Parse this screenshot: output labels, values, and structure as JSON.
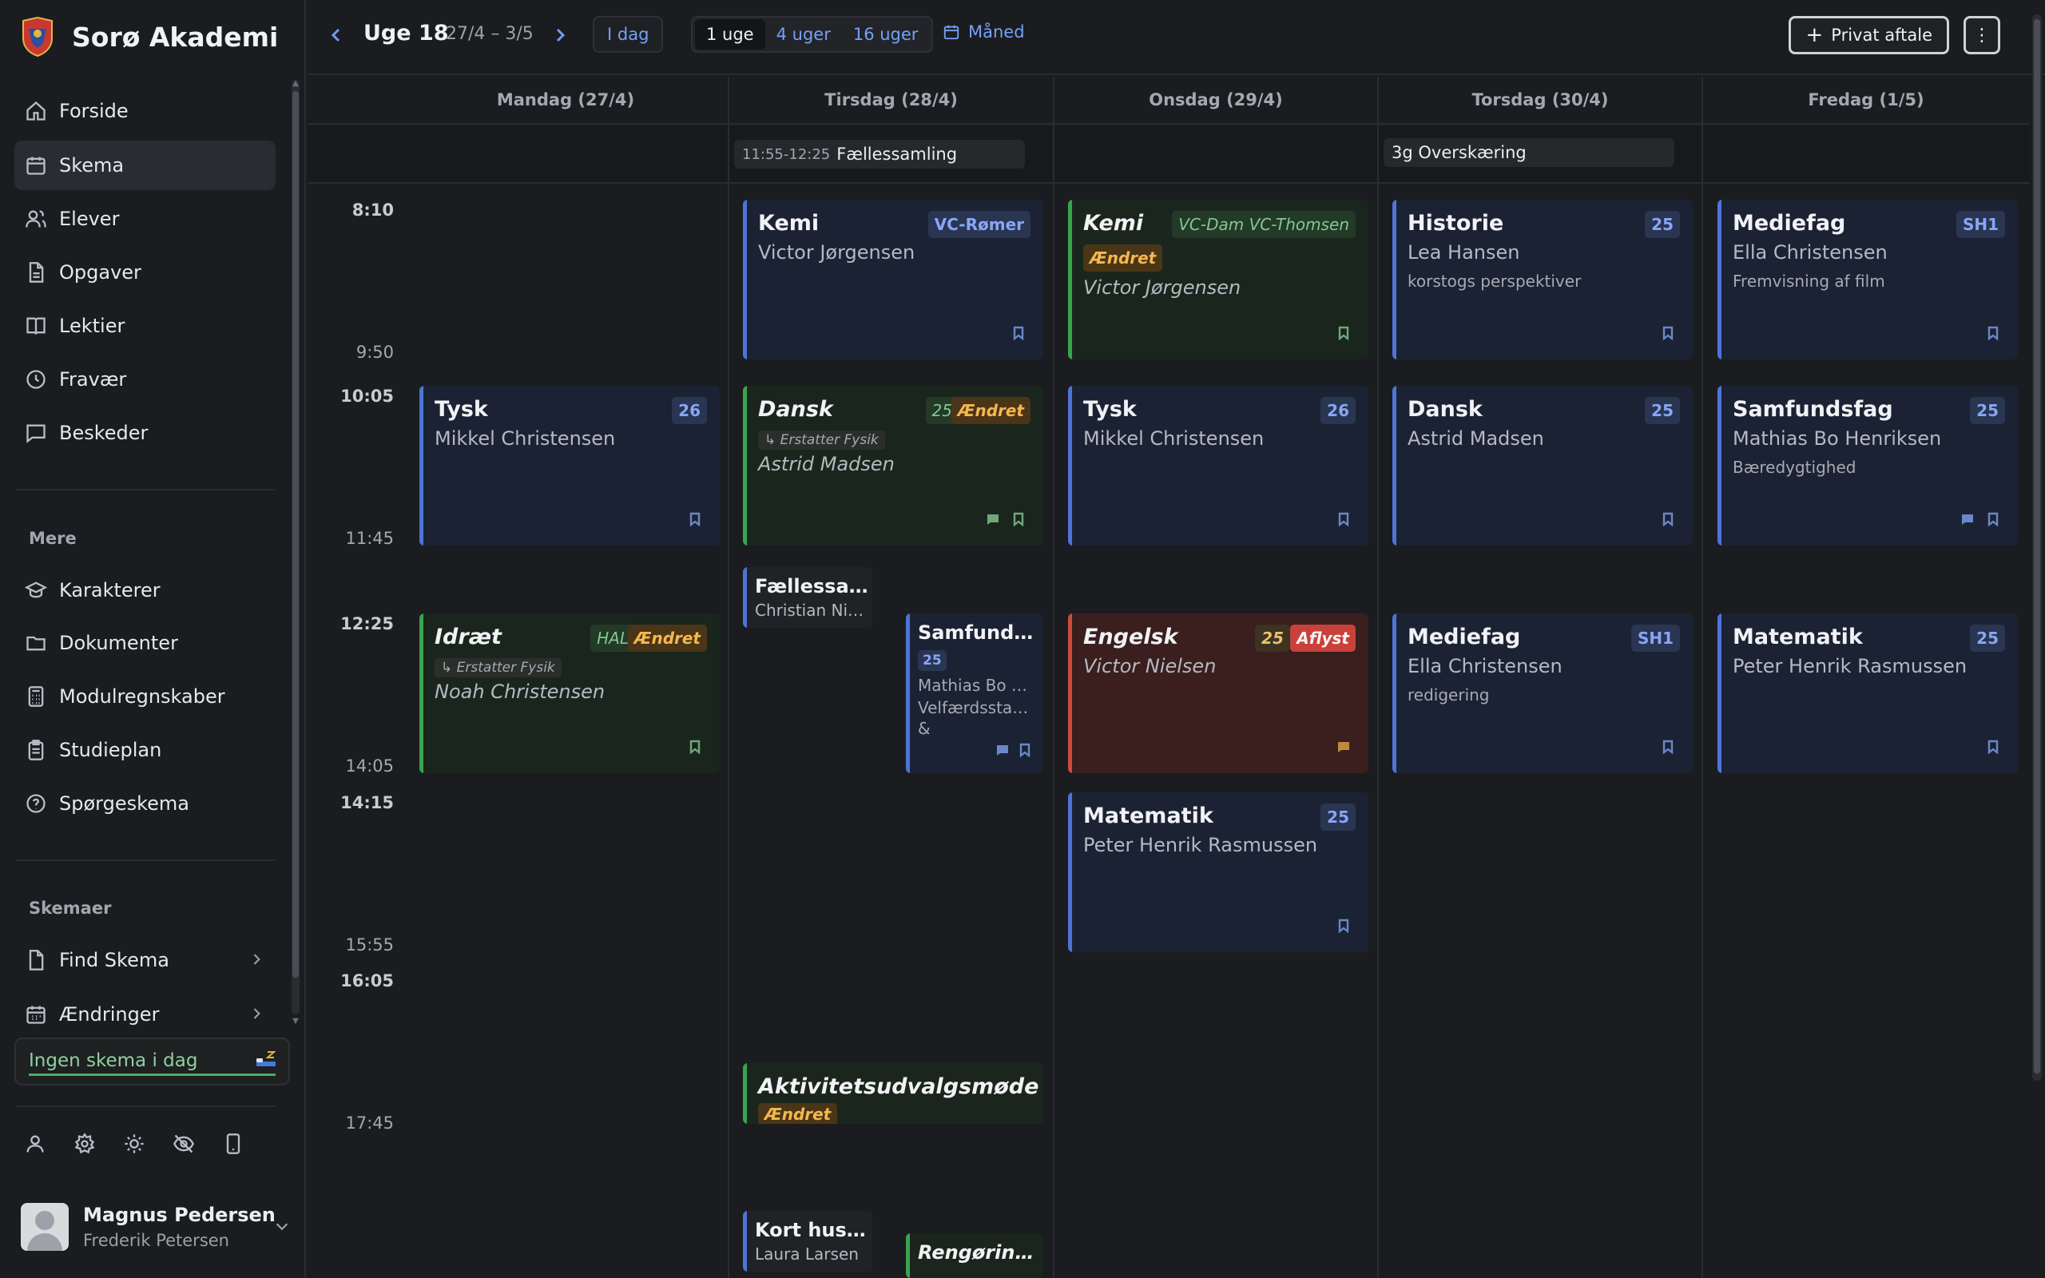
{
  "app": {
    "name": "Sorø Akademi"
  },
  "nav": {
    "main": [
      "Forside",
      "Skema",
      "Elever",
      "Opgaver",
      "Lektier",
      "Fravær",
      "Beskeder"
    ],
    "more_title": "Mere",
    "more": [
      "Karakterer",
      "Dokumenter",
      "Modulregnskaber",
      "Studieplan",
      "Spørgeskema"
    ],
    "schedules_title": "Skemaer",
    "schedules": [
      "Find Skema",
      "Ændringer"
    ],
    "no_schedule": "Ingen skema i dag"
  },
  "user": {
    "name": "Magnus Pedersen",
    "sub": "Frederik Petersen"
  },
  "topbar": {
    "week": "Uge 18",
    "range": "27/4 – 3/5",
    "today": "I dag",
    "views": [
      "1 uge",
      "4 uger",
      "16 uger"
    ],
    "active_view": "1 uge",
    "month": "Måned",
    "private": "Privat aftale",
    "more": "⋮"
  },
  "days": [
    "Mandag (27/4)",
    "Tirsdag (28/4)",
    "Onsdag (29/4)",
    "Torsdag (30/4)",
    "Fredag (1/5)"
  ],
  "allday": [
    {
      "time": "11:55-12:25",
      "title": "Fællessamling"
    },
    {
      "title": "3g Overskæring"
    }
  ],
  "times": [
    "8:10",
    "9:50",
    "10:05",
    "11:45",
    "12:25",
    "14:05",
    "14:15",
    "15:55",
    "16:05",
    "17:45"
  ],
  "events": {
    "tue_kemi": {
      "title": "Kemi",
      "teacher": "Victor Jørgensen",
      "badge": "VC-Rømer"
    },
    "wed_kemi": {
      "title": "Kemi",
      "teacher": "Victor Jørgensen",
      "badge": "VC-Dam VC-Thomsen",
      "status": "Ændret"
    },
    "thu_historie": {
      "title": "Historie",
      "teacher": "Lea Hansen",
      "badge": "25",
      "note": "korstogs perspektiver"
    },
    "fri_mediefag": {
      "title": "Mediefag",
      "teacher": "Ella Christensen",
      "badge": "SH1",
      "note": "Fremvisning af film"
    },
    "mon_tysk": {
      "title": "Tysk",
      "teacher": "Mikkel Christensen",
      "badge": "26"
    },
    "tue_dansk": {
      "title": "Dansk",
      "teacher": "Astrid Madsen",
      "badge": "25",
      "status": "Ændret",
      "replaces": "↳ Erstatter Fysik"
    },
    "wed_tysk": {
      "title": "Tysk",
      "teacher": "Mikkel Christensen",
      "badge": "26"
    },
    "thu_dansk": {
      "title": "Dansk",
      "teacher": "Astrid Madsen",
      "badge": "25"
    },
    "fri_samf": {
      "title": "Samfundsfag",
      "teacher": "Mathias Bo Henriksen",
      "badge": "25",
      "note": "Bæredygtighed"
    },
    "tue_faelles": {
      "title": "Fællessa…",
      "teacher": "Christian Ni…"
    },
    "mon_idraet": {
      "title": "Idræt",
      "teacher": "Noah Christensen",
      "badge": "HAL",
      "status": "Ændret",
      "replaces": "↳ Erstatter Fysik"
    },
    "tue_samf": {
      "title": "Samfund…",
      "badge": "25",
      "teacher": "Mathias Bo …",
      "note1": "Velfærdssta…",
      "note2": "&"
    },
    "wed_engelsk": {
      "title": "Engelsk",
      "teacher": "Victor Nielsen",
      "badge": "25",
      "status": "Aflyst"
    },
    "thu_mediefag": {
      "title": "Mediefag",
      "teacher": "Ella Christensen",
      "badge": "SH1",
      "note": "redigering"
    },
    "fri_mat": {
      "title": "Matematik",
      "teacher": "Peter Henrik Rasmussen",
      "badge": "25"
    },
    "wed_mat": {
      "title": "Matematik",
      "teacher": "Peter Henrik Rasmussen",
      "badge": "25"
    },
    "tue_aktiv": {
      "title": "Aktivitetsudvalgsmøde",
      "status": "Ændret"
    },
    "tue_kort": {
      "title": "Kort hus…",
      "teacher": "Laura Larsen"
    },
    "tue_reng": {
      "title": "Rengørin…"
    }
  }
}
